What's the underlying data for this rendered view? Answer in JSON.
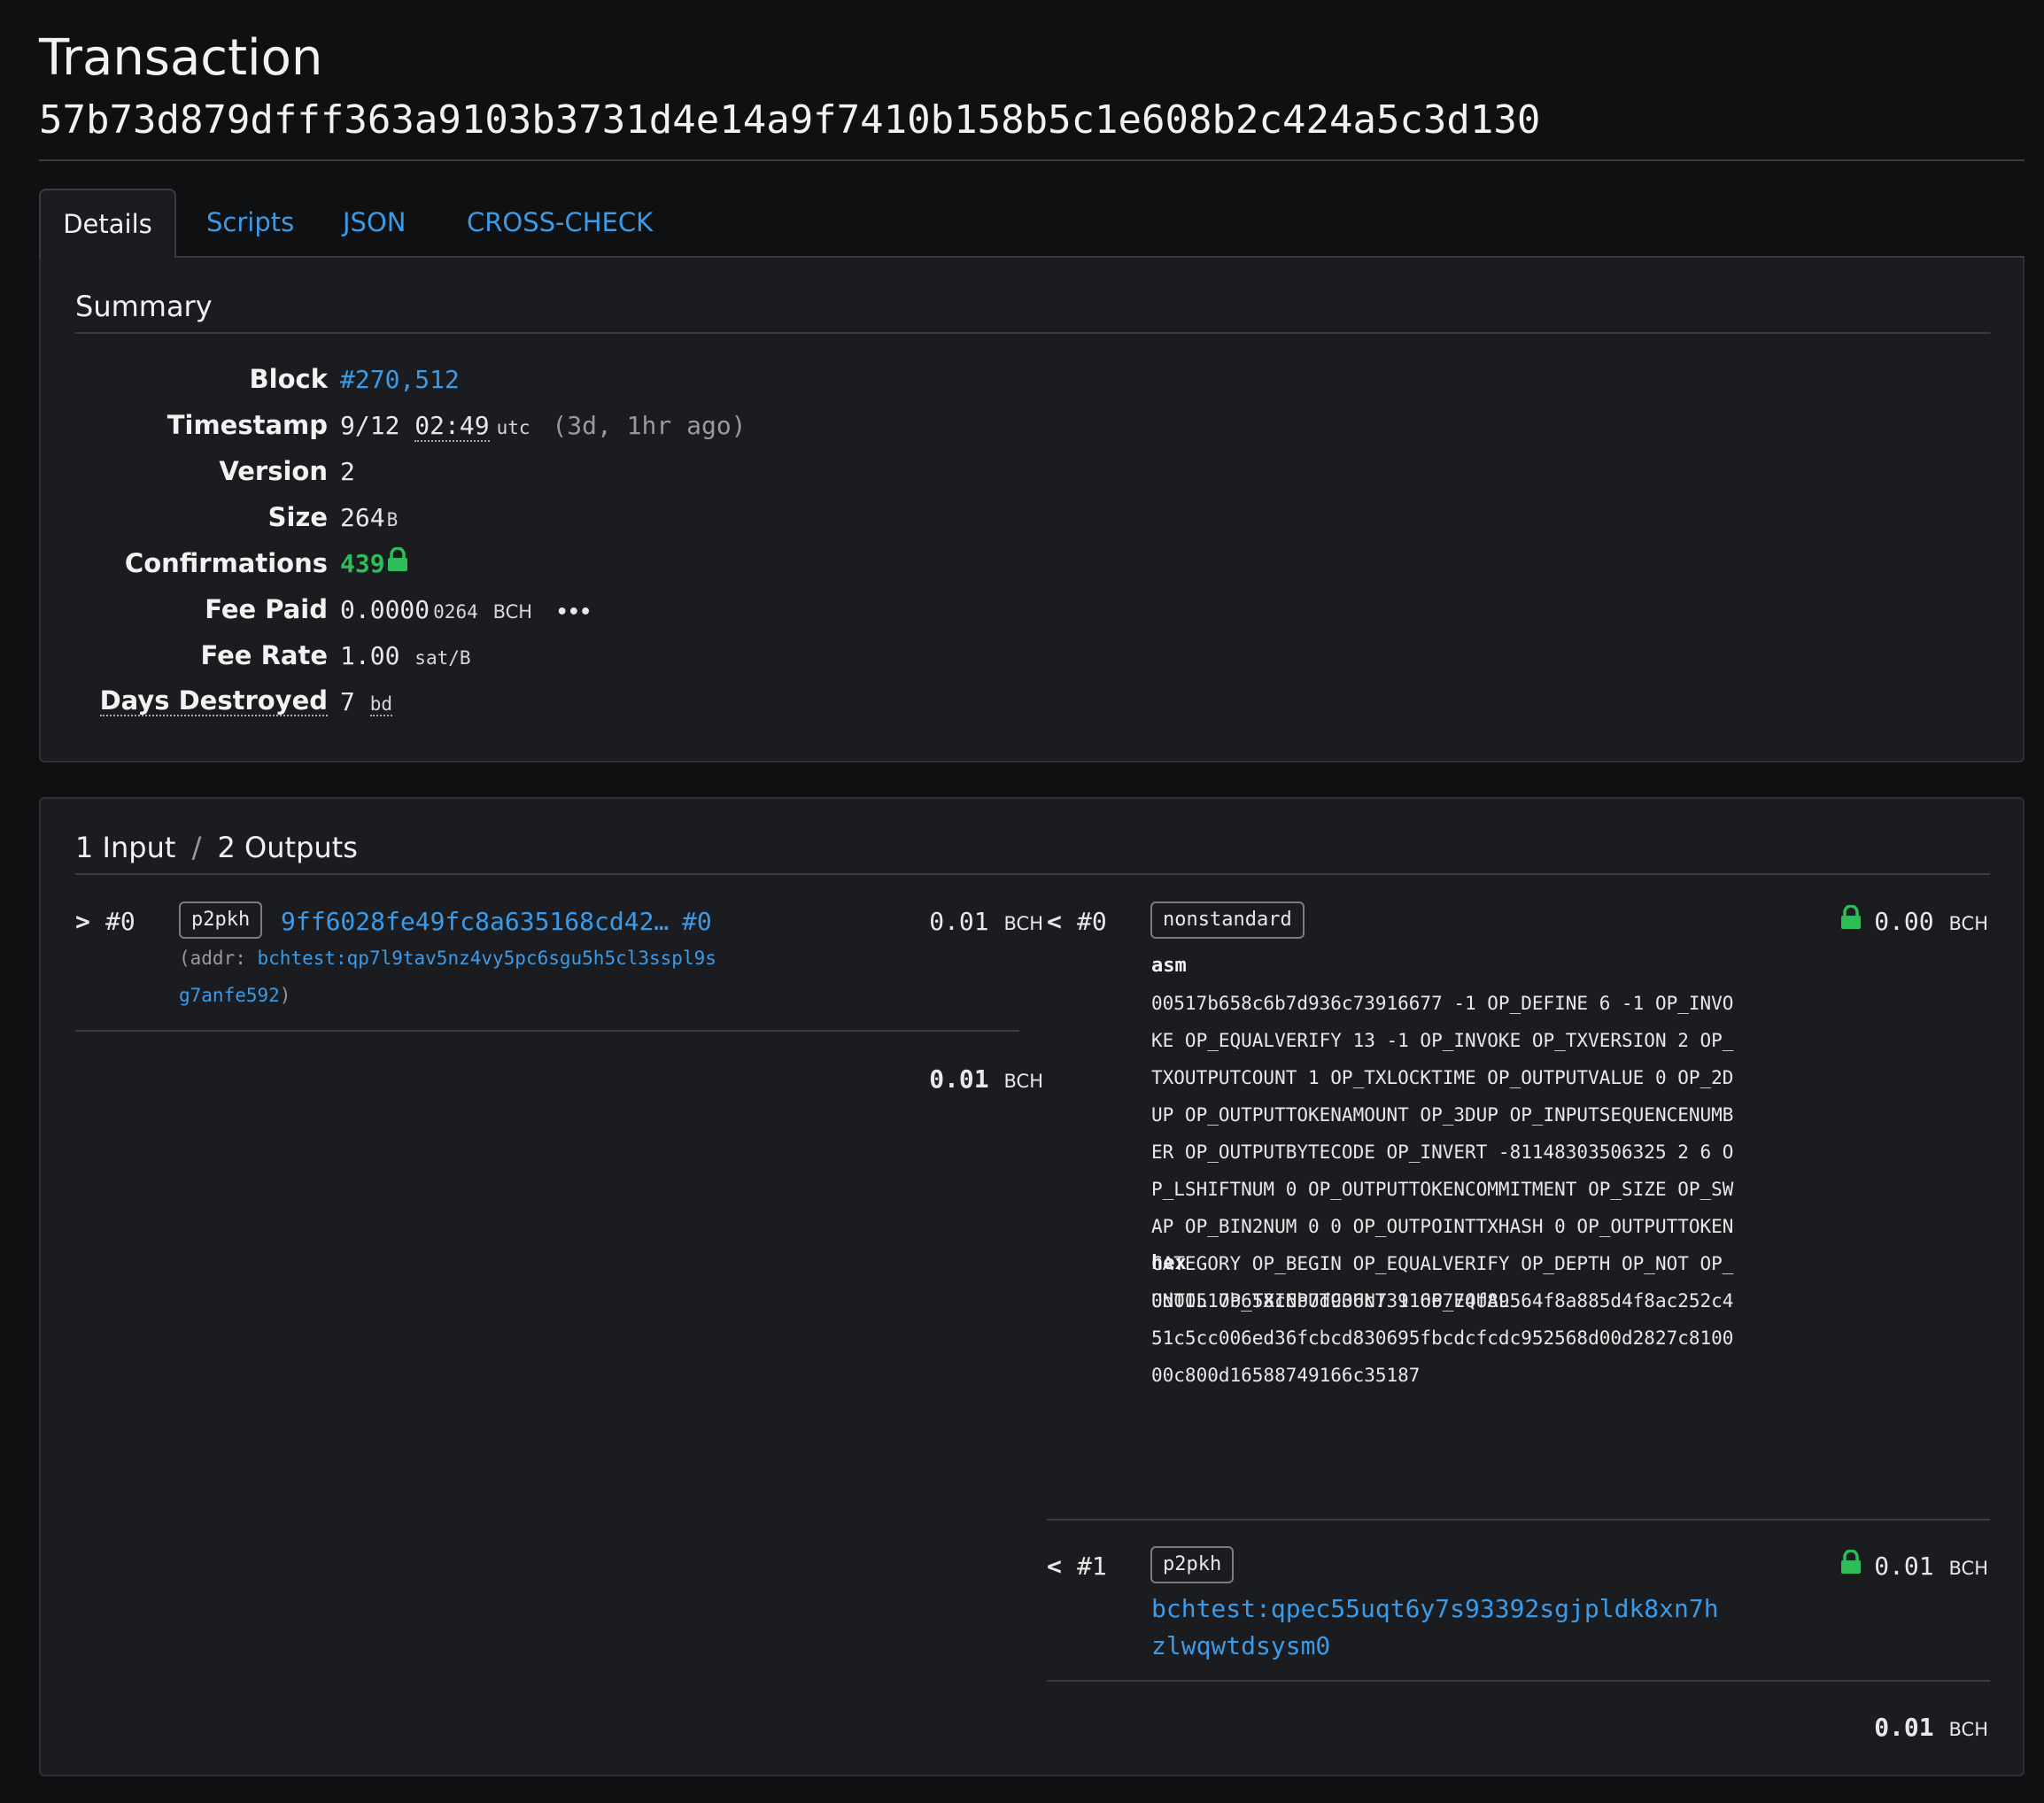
{
  "header": {
    "title": "Transaction",
    "txid": "57b73d879dfff363a9103b3731d4e14a9f7410b158b5c1e608b2c424a5c3d130"
  },
  "tabs": [
    {
      "label": "Details",
      "active": true
    },
    {
      "label": "Scripts",
      "active": false
    },
    {
      "label": "JSON",
      "active": false
    },
    {
      "label": "CROSS-CHECK",
      "active": false
    }
  ],
  "summary": {
    "heading": "Summary",
    "block_label": "Block",
    "block_value": "#270,512",
    "timestamp_label": "Timestamp",
    "timestamp_date": "9/12",
    "timestamp_time": "02:49",
    "timestamp_zone": "utc",
    "timestamp_ago": "(3d, 1hr ago)",
    "version_label": "Version",
    "version_value": "2",
    "size_label": "Size",
    "size_value": "264",
    "size_unit": "B",
    "confirmations_label": "Confirmations",
    "confirmations_value": "439",
    "fee_paid_label": "Fee Paid",
    "fee_paid_main": "0.0000",
    "fee_paid_small": "0264",
    "fee_paid_unit": "BCH",
    "fee_paid_more": "•••",
    "fee_rate_label": "Fee Rate",
    "fee_rate_value": "1.00",
    "fee_rate_unit": "sat/B",
    "days_destroyed_label": "Days Destroyed",
    "days_destroyed_value": "7",
    "days_destroyed_unit": "bd"
  },
  "io": {
    "heading_inputs": "1 Input",
    "heading_sep": "/",
    "heading_outputs": "2 Outputs",
    "inputs": [
      {
        "marker": ">",
        "index": "#0",
        "type": "p2pkh",
        "prev_tx": "9ff6028fe49fc8a635168cd42…",
        "prev_index": "#0",
        "addr_prefix": "(addr:",
        "addr_line1": "bchtest:qp7l9tav5nz4vy5pc6sgu5h5cl3sspl9s",
        "addr_line2": "g7anfe592",
        "addr_suffix": ")",
        "amount": "0.01",
        "unit": "BCH"
      }
    ],
    "input_total": "0.01",
    "input_total_unit": "BCH",
    "outputs": [
      {
        "marker": "<",
        "index": "#0",
        "type": "nonstandard",
        "asm_label": "asm",
        "asm": "00517b658c6b7d936c73916677 -1 OP_DEFINE 6 -1 OP_INVOKE OP_EQUALVERIFY 13 -1 OP_INVOKE OP_TXVERSION 2 OP_TXOUTPUTCOUNT 1 OP_TXLOCKTIME OP_OUTPUTVALUE 0 OP_2DUP OP_OUTPUTTOKENAMOUNT OP_3DUP OP_INPUTSEQUENCENUMBER OP_OUTPUTBYTECODE OP_INVERT -81148303506325 2 6 OP_LSHIFTNUM 0 OP_OUTPUTTOKENCOMMITMENT OP_SIZE OP_SWAP OP_BIN2NUM 0 0 OP_OUTPOINTTXHASH 0 OP_OUTPUTTOKENCATEGORY OP_BEGIN OP_EQUALVERIFY OP_DEPTH OP_NOT OP_UNTIL OP_TXINPUTCOUNT 1 OP_EQUAL",
        "hex_label": "hex",
        "hex": "0d00517b658c6b7d936c739166774f89564f8a885d4f8ac252c451c5cc006ed36fcbcd830695fbcdcfcdc952568d00d2827c810000c800d16588749166c35187",
        "amount": "0.00",
        "unit": "BCH"
      },
      {
        "marker": "<",
        "index": "#1",
        "type": "p2pkh",
        "address_line1": "bchtest:qpec55uqt6y7s93392sgjpldk8xn7h",
        "address_line2": "zlwqwtdsysm0",
        "amount": "0.01",
        "unit": "BCH"
      }
    ],
    "output_total": "0.01",
    "output_total_unit": "BCH"
  },
  "colors": {
    "background": "#0f1011",
    "panel": "#1a1c1f",
    "link": "#3b9be8",
    "success": "#2dbe5a"
  },
  "icons": {
    "lock": "lock-icon",
    "more": "ellipsis-icon"
  }
}
